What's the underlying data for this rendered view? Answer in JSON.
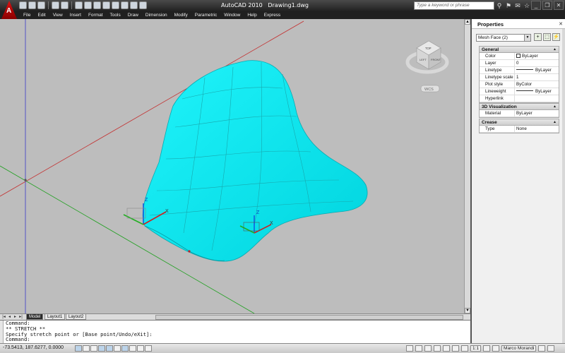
{
  "titlebar": {
    "app_name": "AutoCAD 2010",
    "document": "Drawing1.dwg",
    "search_placeholder": "Type a keyword or phrase",
    "app_logo_letter": "A"
  },
  "menu": [
    "File",
    "Edit",
    "View",
    "Insert",
    "Format",
    "Tools",
    "Draw",
    "Dimension",
    "Modify",
    "Parametric",
    "Window",
    "Help",
    "Express"
  ],
  "viewcube": {
    "top": "TOP",
    "front": "LEFT",
    "right": "FRONT",
    "wcs": "WCS"
  },
  "ucs": {
    "x": "X",
    "y": "Y",
    "z": "Z"
  },
  "tabs": [
    "Model",
    "Layout1",
    "Layout2"
  ],
  "command": {
    "lines": [
      "Command:",
      "** STRETCH **",
      "Specify stretch point or [Base point/Undo/eXit]:",
      "Command:"
    ]
  },
  "status": {
    "coords": "-73.5413, 187.6277, 0.0000",
    "scale": "1:1",
    "workspace": "Marco Morandi"
  },
  "properties": {
    "title": "Properties",
    "selection": "Mesh Face (2)",
    "sections": [
      {
        "name": "General",
        "rows": [
          {
            "key": "Color",
            "value": "ByLayer",
            "kind": "swatch"
          },
          {
            "key": "Layer",
            "value": "0"
          },
          {
            "key": "Linetype",
            "value": "ByLayer",
            "kind": "line"
          },
          {
            "key": "Linetype scale",
            "value": "1"
          },
          {
            "key": "Plot style",
            "value": "ByColor"
          },
          {
            "key": "Lineweight",
            "value": "ByLayer",
            "kind": "line"
          },
          {
            "key": "Hyperlink",
            "value": ""
          }
        ]
      },
      {
        "name": "3D Visualization",
        "rows": [
          {
            "key": "Material",
            "value": "ByLayer"
          }
        ]
      },
      {
        "name": "Crease",
        "rows": [
          {
            "key": "Type",
            "value": "None"
          }
        ]
      }
    ]
  },
  "colors": {
    "mesh": "#00e5ee",
    "viewport_bg": "#bdbdbd",
    "x_axis_line": "#c00000",
    "y_axis_line": "#00a000",
    "z_axis_line": "#3030c0"
  }
}
